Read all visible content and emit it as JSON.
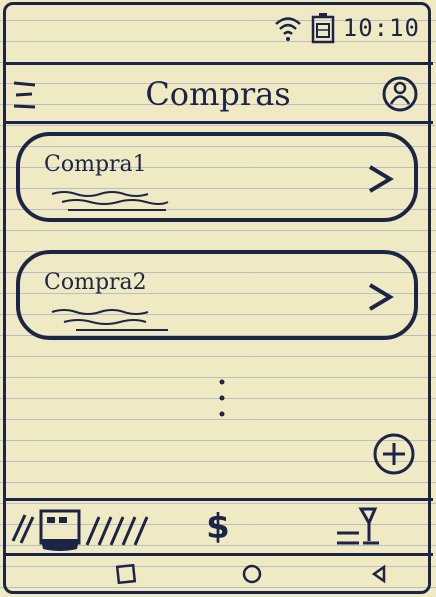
{
  "status_bar": {
    "time": "10:10",
    "icons": [
      "wifi-icon",
      "battery-icon"
    ]
  },
  "header": {
    "title": "Compras",
    "menu_icon": "hamburger-menu-icon",
    "profile_icon": "profile-icon"
  },
  "purchases": [
    {
      "label": "Compra1"
    },
    {
      "label": "Compra2"
    }
  ],
  "fab": {
    "icon": "plus-icon"
  },
  "bottom_nav": [
    {
      "icon": "purchases-tab-icon",
      "selected": true
    },
    {
      "icon": "dollar-icon",
      "label": "$"
    },
    {
      "icon": "split-drink-icon"
    }
  ],
  "system_nav": [
    "square-button-icon",
    "circle-button-icon",
    "triangle-button-icon"
  ],
  "colors": {
    "ink": "#1d2547",
    "paper": "#efe9c4",
    "rule": "#788cbe"
  }
}
